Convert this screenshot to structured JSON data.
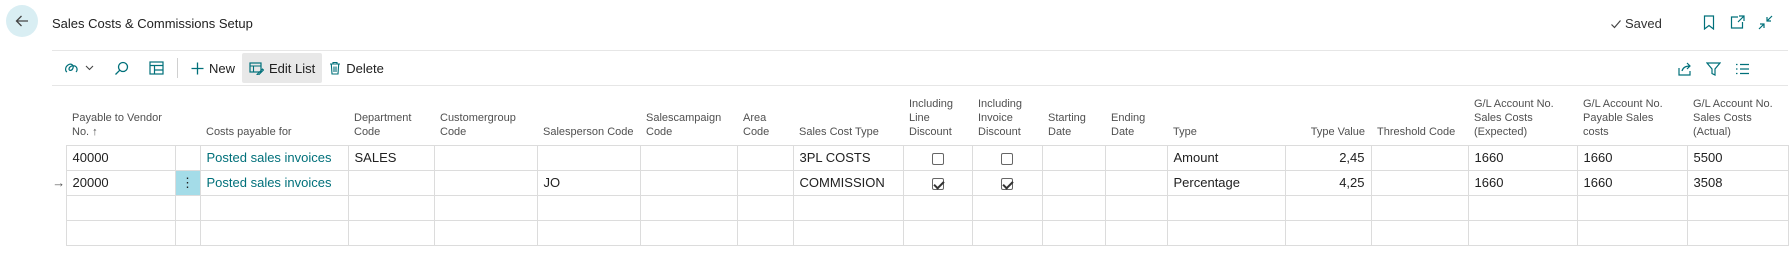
{
  "header": {
    "title": "Sales Costs & Commissions Setup",
    "saved_label": "Saved"
  },
  "toolbar": {
    "new_label": "New",
    "edit_list_label": "Edit List",
    "delete_label": "Delete"
  },
  "columns": {
    "payable_to_vendor_no": "Payable to Vendor No. ↑",
    "costs_payable_for": "Costs payable for",
    "department_code": "Department Code",
    "customergroup_code": "Customergroup Code",
    "salesperson_code": "Salesperson Code",
    "salescampaign_code": "Salescampaign Code",
    "area_code": "Area Code",
    "sales_cost_type": "Sales Cost Type",
    "including_line_discount": "Including Line Discount",
    "including_invoice_discount": "Including Invoice Discount",
    "starting_date": "Starting Date",
    "ending_date": "Ending Date",
    "type": "Type",
    "type_value": "Type Value",
    "threshold_code": "Threshold Code",
    "gl_sales_costs_expected": "G/L Account No. Sales Costs (Expected)",
    "gl_payable_sales_costs": "G/L Account No. Payable Sales costs",
    "gl_sales_costs_actual": "G/L Account No. Sales Costs (Actual)"
  },
  "rows": [
    {
      "vendor_no": "40000",
      "costs_payable_for": "Posted sales invoices",
      "department_code": "SALES",
      "customergroup_code": "",
      "salesperson_code": "",
      "salescampaign_code": "",
      "area_code": "",
      "sales_cost_type": "3PL COSTS",
      "including_line_discount": false,
      "including_invoice_discount": false,
      "starting_date": "",
      "ending_date": "",
      "type": "Amount",
      "type_value": "2,45",
      "threshold_code": "",
      "gl_expected": "1660",
      "gl_payable": "1660",
      "gl_actual": "5500"
    },
    {
      "vendor_no": "20000",
      "costs_payable_for": "Posted sales invoices",
      "department_code": "",
      "customergroup_code": "",
      "salesperson_code": "JO",
      "salescampaign_code": "",
      "area_code": "",
      "sales_cost_type": "COMMISSION",
      "including_line_discount": true,
      "including_invoice_discount": true,
      "starting_date": "",
      "ending_date": "",
      "type": "Percentage",
      "type_value": "4,25",
      "threshold_code": "",
      "gl_expected": "1660",
      "gl_payable": "1660",
      "gl_actual": "3508"
    }
  ],
  "current_row_marker": "→",
  "row_menu_glyph": "⋮",
  "colors": {
    "accent": "#00707a",
    "selected_cell": "#a4dce8",
    "back_button_bg": "#d9eef3"
  }
}
